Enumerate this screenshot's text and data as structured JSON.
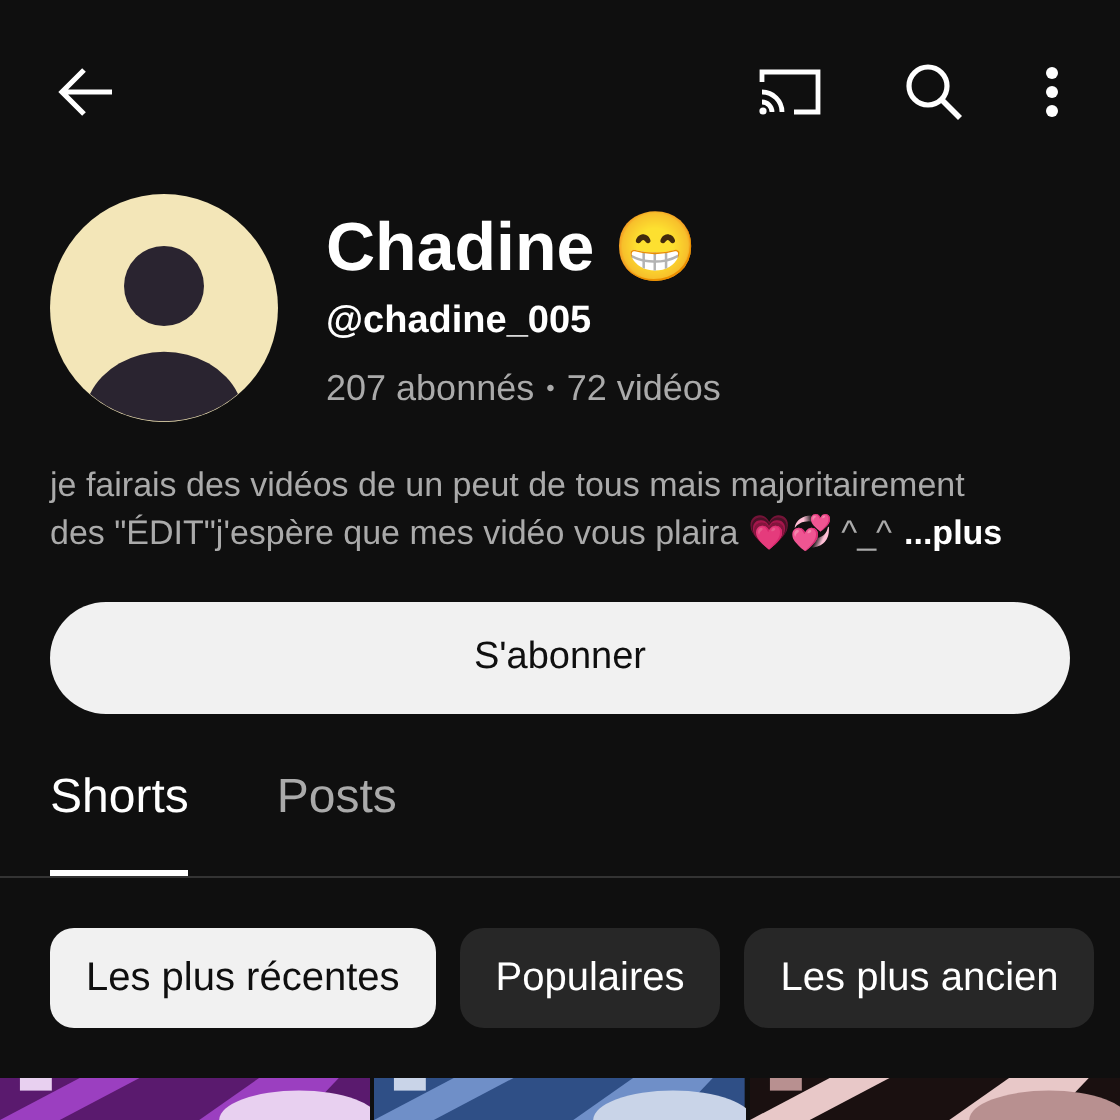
{
  "channel": {
    "name": "Chadine 😁",
    "handle": "@chadine_005",
    "stats": [
      "207 abonnés",
      "72 vidéos"
    ],
    "stats_separator": "•",
    "description_lines": [
      "je fairais des vidéos de un peut de tous mais majoritairement",
      "des \"ÉDIT\"j'espère que mes vidéo vous plaira 💗💞 ^_^"
    ],
    "more": "...plus"
  },
  "subscribe_button": "S'abonner",
  "tabs": [
    {
      "label": "Shorts",
      "selected": true
    },
    {
      "label": "Posts",
      "selected": false
    }
  ],
  "filters": [
    {
      "label": "Les plus récentes",
      "selected": true
    },
    {
      "label": "Populaires",
      "selected": false
    },
    {
      "label": "Les plus ancien",
      "selected": false
    }
  ]
}
